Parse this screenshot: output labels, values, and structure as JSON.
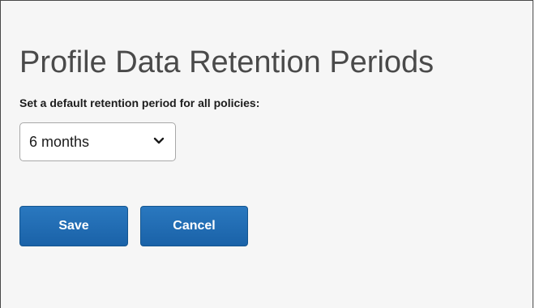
{
  "page": {
    "title": "Profile Data Retention Periods"
  },
  "retention": {
    "label": "Set a default retention period for all policies:",
    "selected": "6 months",
    "icon": "chevron-down-icon"
  },
  "actions": {
    "save_label": "Save",
    "cancel_label": "Cancel"
  },
  "colors": {
    "button": "#1f6cb3",
    "background": "#f6f6f6",
    "title": "#4a4a4a"
  }
}
